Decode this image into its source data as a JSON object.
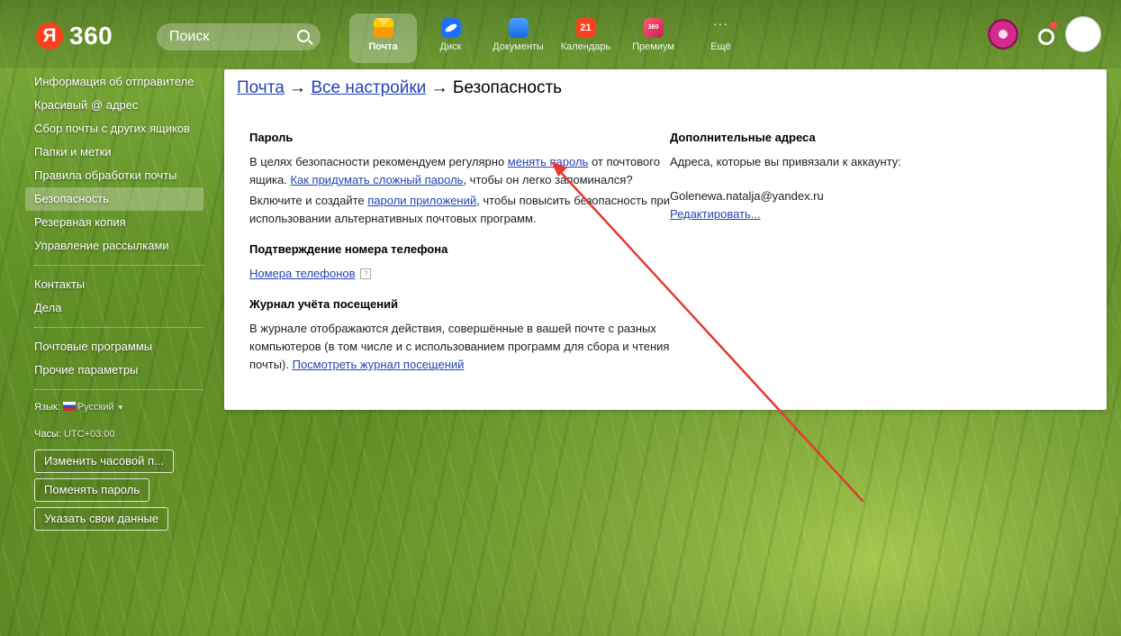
{
  "header": {
    "logo_mark": "Я",
    "logo_text": "360",
    "search_placeholder": "Поиск",
    "services": [
      {
        "label": "Почта",
        "icon": "mail-icon",
        "active": true
      },
      {
        "label": "Диск",
        "icon": "disk-icon"
      },
      {
        "label": "Документы",
        "icon": "documents-icon"
      },
      {
        "label": "Календарь",
        "icon": "calendar-icon",
        "badge": "21"
      },
      {
        "label": "Премиум",
        "icon": "premium-icon",
        "badge": "360"
      },
      {
        "label": "Ещё",
        "icon": "more-icon",
        "badge": "···"
      }
    ]
  },
  "sidebar": {
    "items": [
      {
        "label": "Информация об отправителе"
      },
      {
        "label": "Красивый @ адрес"
      },
      {
        "label": "Сбор почты с других ящиков"
      },
      {
        "label": "Папки и метки"
      },
      {
        "label": "Правила обработки почты"
      },
      {
        "label": "Безопасность",
        "active": true
      },
      {
        "label": "Резервная копия"
      },
      {
        "label": "Управление рассылками"
      }
    ],
    "items2": [
      {
        "label": "Контакты"
      },
      {
        "label": "Дела"
      }
    ],
    "items3": [
      {
        "label": "Почтовые программы"
      },
      {
        "label": "Прочие параметры"
      }
    ],
    "language_label": "Язык:",
    "language_value": "Русский",
    "language_caret": "▼",
    "clock_label": "Часы:",
    "clock_value": "UTC+03:00",
    "btn_timezone": "Изменить часовой п...",
    "btn_password": "Поменять пароль",
    "btn_data": "Указать свои данные"
  },
  "main": {
    "crumb1": "Почта",
    "crumb_sep": "→",
    "crumb2": "Все настройки",
    "crumb3": "Безопасность",
    "password": {
      "title": "Пароль",
      "t1": "В целях безопасности рекомендуем регулярно ",
      "link1": "менять пароль",
      "t2": " от почтового ящика. ",
      "link2": "Как придумать сложный пароль",
      "t3": ", чтобы он легко запоминался?",
      "t4": "Включите и создайте ",
      "link3": "пароли приложений",
      "t5": ", чтобы повысить безопасность при использовании альтернативных почтовых программ."
    },
    "phone": {
      "title": "Подтверждение номера телефона",
      "link": "Номера телефонов",
      "help": "?"
    },
    "journal": {
      "title": "Журнал учёта посещений",
      "text": "В журнале отображаются действия, совершённые в вашей почте с разных компьютеров (в том числе и с использованием программ для сбора и чтения почты). ",
      "link": "Посмотреть журнал посещений"
    },
    "extra": {
      "title": "Дополнительные адреса",
      "text": "Адреса, которые вы привязали к аккаунту:",
      "email": "Golenewa.natalja@yandex.ru",
      "edit": "Редактировать..."
    }
  },
  "annotation": {
    "arrow_color": "#e53935"
  }
}
